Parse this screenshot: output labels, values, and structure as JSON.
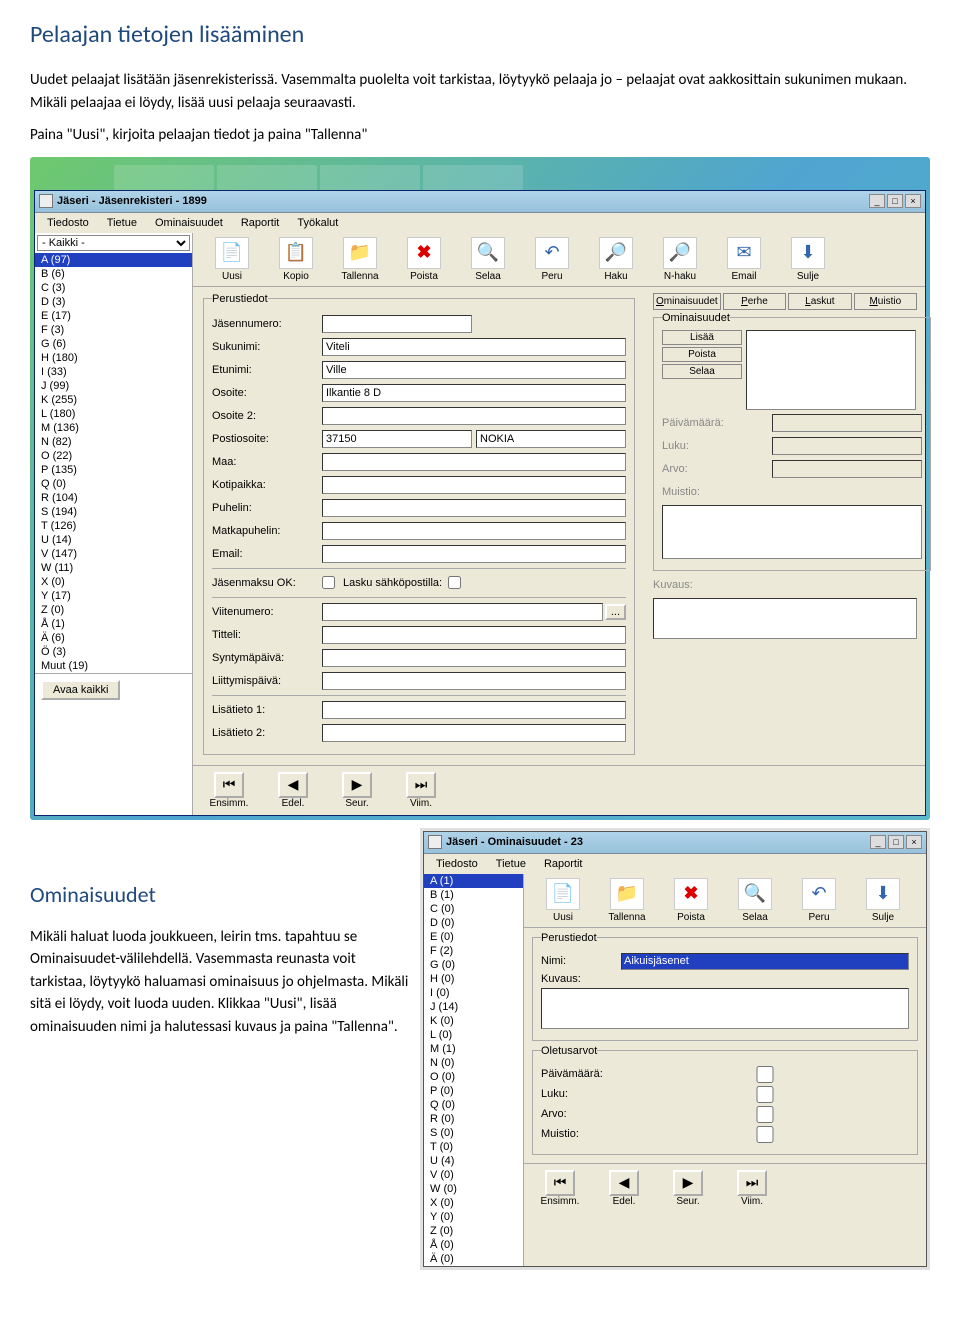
{
  "headings": {
    "h1": "Pelaajan tietojen lisääminen",
    "h2": "Ominaisuudet"
  },
  "intro": {
    "p1": "Uudet pelaajat lisätään jäsenrekisterissä. Vasemmalta puolelta voit tarkistaa, löytyykö pelaaja jo – pelaajat ovat aakkosittain sukunimen mukaan. Mikäli pelaajaa ei löydy, lisää uusi pelaaja seuraavasti.",
    "p2": "Paina \"Uusi\", kirjoita pelaajan tiedot ja paina \"Tallenna\""
  },
  "lower_text": "Mikäli haluat luoda joukkueen, leirin tms. tapahtuu se Ominaisuudet-välilehdellä. Vasemmasta reunasta voit tarkistaa, löytyykö haluamasi ominaisuus jo ohjelmasta. Mikäli sitä ei löydy, voit luoda uuden. Klikkaa \"Uusi\", lisää ominaisuuden nimi ja halutessasi kuvaus ja paina \"Tallenna\".",
  "win1": {
    "title": "Jäseri - Jäsenrekisteri - 1899",
    "menus": [
      "Tiedosto",
      "Tietue",
      "Ominaisuudet",
      "Raportit",
      "Työkalut"
    ],
    "filter_select": "- Kaikki -",
    "alpha": [
      {
        "l": "A",
        "n": 97
      },
      {
        "l": "B",
        "n": 6
      },
      {
        "l": "C",
        "n": 3
      },
      {
        "l": "D",
        "n": 3
      },
      {
        "l": "E",
        "n": 17
      },
      {
        "l": "F",
        "n": 3
      },
      {
        "l": "G",
        "n": 6
      },
      {
        "l": "H",
        "n": 180
      },
      {
        "l": "I",
        "n": 33
      },
      {
        "l": "J",
        "n": 99
      },
      {
        "l": "K",
        "n": 255
      },
      {
        "l": "L",
        "n": 180
      },
      {
        "l": "M",
        "n": 136
      },
      {
        "l": "N",
        "n": 82
      },
      {
        "l": "O",
        "n": 22
      },
      {
        "l": "P",
        "n": 135
      },
      {
        "l": "Q",
        "n": 0
      },
      {
        "l": "R",
        "n": 104
      },
      {
        "l": "S",
        "n": 194
      },
      {
        "l": "T",
        "n": 126
      },
      {
        "l": "U",
        "n": 14
      },
      {
        "l": "V",
        "n": 147
      },
      {
        "l": "W",
        "n": 11
      },
      {
        "l": "X",
        "n": 0
      },
      {
        "l": "Y",
        "n": 17
      },
      {
        "l": "Z",
        "n": 0
      },
      {
        "l": "Å",
        "n": 1
      },
      {
        "l": "Ä",
        "n": 6
      },
      {
        "l": "Ö",
        "n": 3
      },
      {
        "l": "Muut",
        "n": 19
      }
    ],
    "avaa": "Avaa kaikki",
    "toolbar": [
      "Uusi",
      "Kopio",
      "Tallenna",
      "Poista",
      "Selaa",
      "Peru",
      "Haku",
      "N-haku",
      "Email",
      "Sulje"
    ],
    "fieldset1": "Perustiedot",
    "labels": {
      "jasennumero": "Jäsennumero:",
      "sukunimi": "Sukunimi:",
      "etunimi": "Etunimi:",
      "osoite": "Osoite:",
      "osoite2": "Osoite 2:",
      "postiosoite": "Postiosoite:",
      "maa": "Maa:",
      "kotipaikka": "Kotipaikka:",
      "puhelin": "Puhelin:",
      "matkapuhelin": "Matkapuhelin:",
      "email": "Email:",
      "jasenmaksu": "Jäsenmaksu OK:",
      "lasku_sahko": "Lasku sähköpostilla:",
      "viitenumero": "Viitenumero:",
      "titteli": "Titteli:",
      "syntymapaiva": "Syntymäpäivä:",
      "liittymispaiva": "Liittymispäivä:",
      "lisatieto1": "Lisätieto 1:",
      "lisatieto2": "Lisätieto 2:",
      "paivamaara": "Päivämäärä:",
      "luku": "Luku:",
      "arvo": "Arvo:",
      "muistio": "Muistio:",
      "kuvaus": "Kuvaus:"
    },
    "vals": {
      "sukunimi": "Viteli",
      "etunimi": "Ville",
      "osoite": "Ilkantie 8 D",
      "posti_nro": "37150",
      "posti_kaup": "NOKIA"
    },
    "ellipsis": "...",
    "tabs": {
      "omin": "Ominaisuudet",
      "perhe": "Perhe",
      "laskut": "Laskut",
      "muistio": "Muistio"
    },
    "fieldset2": "Ominaisuudet",
    "small_btns": [
      "Lisää",
      "Poista",
      "Selaa"
    ],
    "nav": [
      "Ensimm.",
      "Edel.",
      "Seur.",
      "Viim."
    ]
  },
  "win2": {
    "title": "Jäseri - Ominaisuudet - 23",
    "menus": [
      "Tiedosto",
      "Tietue",
      "Raportit"
    ],
    "alpha": [
      {
        "l": "A",
        "n": 1
      },
      {
        "l": "B",
        "n": 1
      },
      {
        "l": "C",
        "n": 0
      },
      {
        "l": "D",
        "n": 0
      },
      {
        "l": "E",
        "n": 0
      },
      {
        "l": "F",
        "n": 2
      },
      {
        "l": "G",
        "n": 0
      },
      {
        "l": "H",
        "n": 0
      },
      {
        "l": "I",
        "n": 0
      },
      {
        "l": "J",
        "n": 14
      },
      {
        "l": "K",
        "n": 0
      },
      {
        "l": "L",
        "n": 0
      },
      {
        "l": "M",
        "n": 1
      },
      {
        "l": "N",
        "n": 0
      },
      {
        "l": "O",
        "n": 0
      },
      {
        "l": "P",
        "n": 0
      },
      {
        "l": "Q",
        "n": 0
      },
      {
        "l": "R",
        "n": 0
      },
      {
        "l": "S",
        "n": 0
      },
      {
        "l": "T",
        "n": 0
      },
      {
        "l": "U",
        "n": 4
      },
      {
        "l": "V",
        "n": 0
      },
      {
        "l": "W",
        "n": 0
      },
      {
        "l": "X",
        "n": 0
      },
      {
        "l": "Y",
        "n": 0
      },
      {
        "l": "Z",
        "n": 0
      },
      {
        "l": "Å",
        "n": 0
      },
      {
        "l": "Ä",
        "n": 0
      }
    ],
    "toolbar": [
      "Uusi",
      "Tallenna",
      "Poista",
      "Selaa",
      "Peru",
      "Sulje"
    ],
    "fieldset1": "Perustiedot",
    "fieldset2": "Oletusarvot",
    "labels": {
      "nimi": "Nimi:",
      "kuvaus": "Kuvaus:",
      "paivamaara": "Päivämäärä:",
      "luku": "Luku:",
      "arvo": "Arvo:",
      "muistio": "Muistio:"
    },
    "nimi_val": "Aikuisjäsenet",
    "nav": [
      "Ensimm.",
      "Edel.",
      "Seur.",
      "Viim."
    ]
  }
}
